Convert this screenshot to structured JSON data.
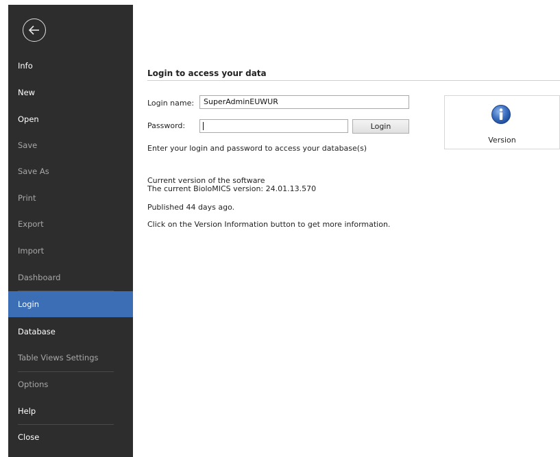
{
  "sidebar": {
    "back_icon": "arrow-left-circle-icon",
    "items": [
      {
        "label": "Info"
      },
      {
        "label": "New"
      },
      {
        "label": "Open"
      },
      {
        "label": "Save"
      },
      {
        "label": "Save As"
      },
      {
        "label": "Print"
      },
      {
        "label": "Export"
      },
      {
        "label": "Import"
      },
      {
        "label": "Dashboard"
      },
      {
        "label": "Login"
      },
      {
        "label": "Database"
      },
      {
        "label": "Table Views Settings"
      },
      {
        "label": "Options"
      },
      {
        "label": "Help"
      },
      {
        "label": "Close"
      }
    ],
    "active_item": "Login",
    "colors": {
      "background": "#2d2d2d",
      "active": "#3b6eb4"
    }
  },
  "login": {
    "section_title": "Login to access your data",
    "login_name_label": "Login name:",
    "login_name_value": "SuperAdminEUWUR",
    "password_label": "Password:",
    "password_value": "",
    "login_button": "Login",
    "hint": "Enter your login and password to access your database(s)"
  },
  "version_tile": {
    "icon": "info-icon",
    "label": "Version"
  },
  "version_info": {
    "heading": "Current version of the software",
    "current_version": "The current BioloMICS version: 24.01.13.570",
    "published": "Published 44 days ago.",
    "click_hint": "Click on the Version Information button to get more information."
  }
}
